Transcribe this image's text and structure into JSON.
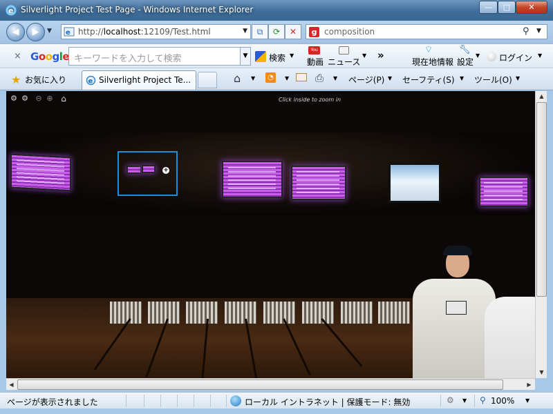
{
  "window": {
    "title": "Silverlight Project Test Page - Windows Internet Explorer",
    "minimize": "—",
    "maximize": "□",
    "close": "✕"
  },
  "address_bar": {
    "url_prefix": "http://",
    "url_host": "localhost",
    "url_rest": ":12109/Test.html"
  },
  "search_box": {
    "value": "composition"
  },
  "google_toolbar": {
    "logo": "Google",
    "close": "×",
    "placeholder": "キーワードを入力して検索",
    "search_label": "検索",
    "video_label": "動画",
    "news_label": "ニュース",
    "more": "»",
    "location_label": "現在地情報",
    "settings_label": "設定",
    "login_label": "ログイン"
  },
  "favorites_bar": {
    "favorites_label": "お気に入り",
    "tab_label": "Silverlight Project Te...",
    "page_menu": "ページ(P)",
    "safety_menu": "セーフティ(S)",
    "tools_menu": "ツール(O)"
  },
  "viewer": {
    "hint": "Click inside to zoom in"
  },
  "status_bar": {
    "status_text": "ページが表示されました",
    "zone_text": "ローカル イントラネット | 保護モード: 無効",
    "zoom_level": "100%"
  },
  "colors": {
    "accent_frame": "#3f6e9c",
    "zoom_box": "#1f8ed6",
    "close_button": "#c4452a"
  }
}
